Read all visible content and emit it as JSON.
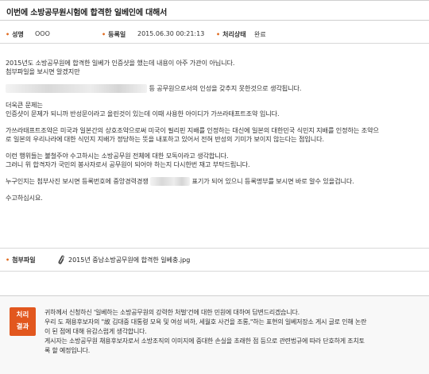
{
  "title": "이번에 소방공무원시험에 합격한 일베인에 대해서",
  "meta": {
    "name_label": "성명",
    "name_value": "OOO",
    "date_label": "등록일",
    "date_value": "2015.06.30 00:21:13",
    "status_label": "처리상태",
    "status_value": "완료"
  },
  "body": {
    "p1_l1": "2015년도 소방공무원에 합격한 일베가 인증샷을 했는데 내용이 아주 가관이 아닙니다.",
    "p1_l2": "첨부파일을 보시면 알겠지만",
    "p1_l3": "등 공무원으로서의 인성을 갖추지 못한것으로 생각됩니다.",
    "p2_l1": "더욱큰 문제는",
    "p2_l2": "인증샷이 문제가 되니까 반성문이라고 올린것이 있는데 이때 사용한 아이디가 가쓰라태프트조약 입니다.",
    "p3_l1": "가쓰라태프트조약은 미국과 일본간의 상호조약으로써 미국이 필리핀 지배를 인정하는 대신에 일본의 대한민국 식민지 지배를 인정하는 조약으",
    "p3_l2": "로 일본의 우리나라에 대한 식민지 지배가 정당하는 뜻을 내포하고 있어서 전혀 반성의 기미가 보이지 않는다는 점입니다.",
    "p4_l1": "이런 행위들는 불철주야 수고하시는 소방공무원 전체에 대한 모독이라고 생각합니다.",
    "p4_l2": "그러니 위 합격자가 국민의 봉사자로서 공무원이 되어야 하는지 다시한번 재고 부탁드립니다.",
    "p5_l1a": "누구인지는 첨부사진 보시면 등록번호에 중앙경력경쟁",
    "p5_l1b": "표기가 되어 있으니 등록명부를 보시면 바로 알수 있을겁니다.",
    "p6_l1": "수고하십시요."
  },
  "attachment": {
    "label": "첨부파일",
    "icon": "paperclip-icon",
    "file_name": "2015년 중남소방공무원에 합격한 일베충.jpg"
  },
  "result": {
    "badge_line1": "처리",
    "badge_line2": "결과",
    "badge_color": "#e2571e",
    "r1": "귀하께서 신청하신 '일베하는 소방공무원의 강력한 처벌'건에 대한 민원에 대하여 답변드리겠습니다.",
    "r2": "우리 도 채용후보자의 \"故 김대중 대통령 모욕 및 여성 비하, 세월호 사건을 조롱,\"하는 표현의 일베저장소 게시 글로 인해 논란",
    "r3": "이 된 점에 대해 유감스럽게 생각합니다.",
    "r4": "게시자는 소방공무원 채용후보자로서 소방조직의 이미지에 중대한 손실을 초래한 점 등으로 관련법규에 따라 단호하게 조치토",
    "r5": "록 할 예정입니다."
  }
}
